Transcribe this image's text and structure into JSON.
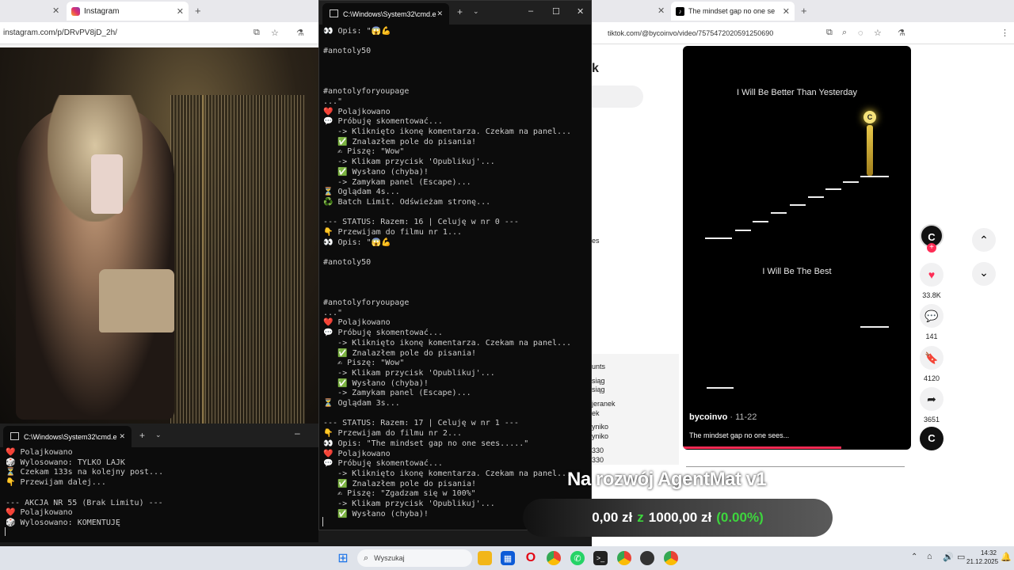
{
  "left_browser": {
    "tab_title": "Instagram",
    "url": "instagram.com/p/DRvPV8jD_2h/"
  },
  "cmd_main": {
    "tab_title": "C:\\Windows\\System32\\cmd.e",
    "lines": [
      "👀 Opis: \"😱💪",
      "",
      "#anotoly50",
      "",
      "",
      "",
      "#anotolyforyoupage",
      "...\"",
      "❤️ Polajkowano",
      "💬 Próbuję skomentować...",
      "   -> Kliknięto ikonę komentarza. Czekam na panel...",
      "   ✅ Znalazłem pole do pisania!",
      "   ✍ Piszę: \"Wow\"",
      "   -> Klikam przycisk 'Opublikuj'...",
      "   ✅ Wysłano (chyba)!",
      "   -> Zamykam panel (Escape)...",
      "⏳ Oglądam 4s...",
      "♻️ Batch Limit. Odświeżam stronę...",
      "",
      "--- STATUS: Razem: 16 | Celuję w nr 0 ---",
      "👇 Przewijam do filmu nr 1...",
      "👀 Opis: \"😱💪",
      "",
      "#anotoly50",
      "",
      "",
      "",
      "#anotolyforyoupage",
      "...\"",
      "❤️ Polajkowano",
      "💬 Próbuję skomentować...",
      "   -> Kliknięto ikonę komentarza. Czekam na panel...",
      "   ✅ Znalazłem pole do pisania!",
      "   ✍ Piszę: \"Wow\"",
      "   -> Klikam przycisk 'Opublikuj'...",
      "   ✅ Wysłano (chyba)!",
      "   -> Zamykam panel (Escape)...",
      "⏳ Oglądam 3s...",
      "",
      "--- STATUS: Razem: 17 | Celuję w nr 1 ---",
      "👇 Przewijam do filmu nr 2...",
      "👀 Opis: \"The mindset gap no one sees.....\"",
      "❤️ Polajkowano",
      "💬 Próbuję skomentować...",
      "   -> Kliknięto ikonę komentarza. Czekam na panel...",
      "   ✅ Znalazłem pole do pisania!",
      "   ✍ Piszę: \"Zgadzam się w 100%\"",
      "   -> Klikam przycisk 'Opublikuj'...",
      "   ✅ Wysłano (chyba)!"
    ]
  },
  "cmd_small": {
    "tab_title": "C:\\Windows\\System32\\cmd.e",
    "lines": [
      "❤️ Polajkowano",
      "🎲 Wylosowano: TYLKO LAJK",
      "⏳ Czekam 133s na kolejny post...",
      "👇 Przewijam dalej...",
      "",
      "--- AKCJA NR 55 (Brak Limitu) ---",
      "❤️ Polajkowano",
      "🎲 Wylosowano: KOMENTUJĘ"
    ]
  },
  "right_browser": {
    "tab_title": "The mindset gap no one se",
    "url": "tiktok.com/@bycoinvo/video/7575472020591250690",
    "video": {
      "top_text": "I Will Be Better Than Yesterday",
      "mid_text": "I Will Be The Best",
      "author": "bycoinvo",
      "date": "· 11-22",
      "caption": "The mindset gap no one sees...",
      "avatar_letter": "C"
    },
    "actions": {
      "likes": "33.8K",
      "comments": "141",
      "saves": "4120",
      "shares": "3651"
    },
    "partial_left": [
      "k",
      "es",
      "unts",
      "siąg",
      "siąg",
      "jeranek",
      "ek",
      "yniko",
      "yniko",
      "330",
      "330"
    ]
  },
  "overlay": {
    "title": "Na rozwój AgentMat v1",
    "current": "0,00 zł",
    "of_word": "z",
    "goal": "1000,00 zł",
    "percent": "(0.00%)"
  },
  "taskbar": {
    "search_placeholder": "Wyszukaj",
    "time": "14:32",
    "date": "21.12.2025"
  }
}
